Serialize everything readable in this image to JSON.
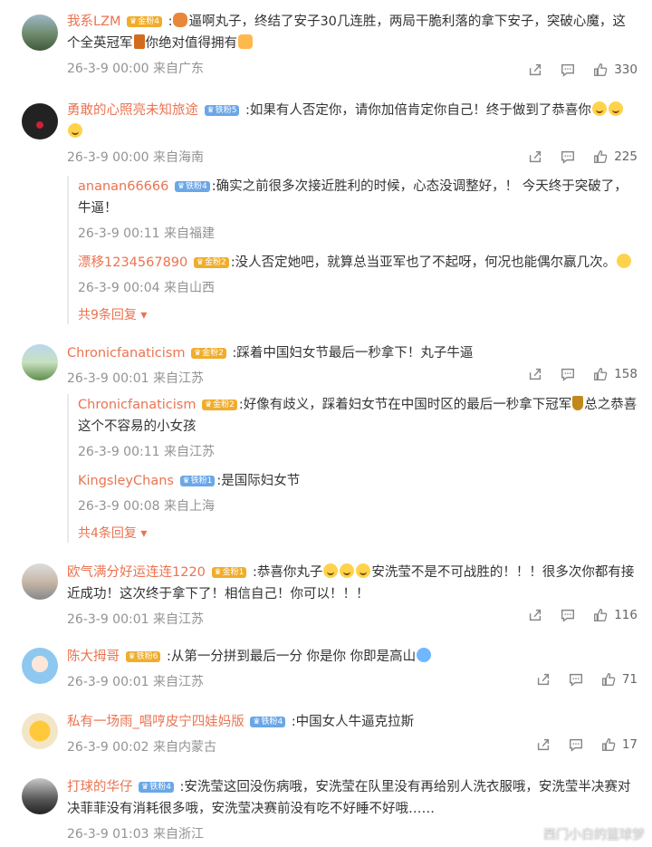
{
  "comments": [
    {
      "user": "我系LZM",
      "badge": "金粉4",
      "text": "逼啊丸子，终结了安子30几连胜，两局干脆利落的拿下安子，突破心魔，这个全英冠军",
      "text2": "你绝对值得拥有",
      "time": "26-3-9 00:00 来自广东",
      "likes": "330"
    },
    {
      "user": "勇敢的心照亮未知旅途",
      "badge": "铁粉5",
      "text": "如果有人否定你，请你加倍肯定你自己！终于做到了恭喜你",
      "time": "26-3-9 00:00 来自海南",
      "likes": "225",
      "replies": [
        {
          "user": "ananan66666",
          "badge": "铁粉4",
          "text": "确实之前很多次接近胜利的时候，心态没调整好，！ 今天终于突破了，牛逼！",
          "time": "26-3-9 00:11 来自福建"
        },
        {
          "user": "漂移1234567890",
          "badge": "金粉2",
          "text": "没人否定她吧，就算总当亚军也了不起呀，何况也能偶尔赢几次。",
          "time": "26-3-9 00:04 来自山西"
        }
      ],
      "more": "共9条回复"
    },
    {
      "user": "Chronicfanaticism",
      "badge": "金粉2",
      "text": "踩着中国妇女节最后一秒拿下！丸子牛逼",
      "time": "26-3-9 00:01 来自江苏",
      "likes": "158",
      "replies": [
        {
          "user": "Chronicfanaticism",
          "badge": "金粉2",
          "text": "好像有歧义，踩着妇女节在中国时区的最后一秒拿下冠军",
          "text2": "总之恭喜这个不容易的小女孩",
          "time": "26-3-9 00:11 来自江苏"
        },
        {
          "user": "KingsleyChans",
          "badge": "铁粉1",
          "text": "是国际妇女节",
          "time": "26-3-9 00:08 来自上海"
        }
      ],
      "more": "共4条回复"
    },
    {
      "user": "欧气满分好运连连1220",
      "badge": "金粉1",
      "text": "恭喜你丸子",
      "text2": "安洗莹不是不可战胜的！！！很多次你都有接近成功！这次终于拿下了！相信自己！你可以！！！",
      "time": "26-3-9 00:01 来自江苏",
      "likes": "116"
    },
    {
      "user": "陈大拇哥",
      "badge": "铁粉6",
      "text": "从第一分拼到最后一分 你是你 你即是高山",
      "time": "26-3-9 00:01 来自江苏",
      "likes": "71"
    },
    {
      "user": "私有一场雨_唱哼皮宁四娃妈版",
      "badge": "铁粉4",
      "text": "中国女人牛逼克拉斯",
      "time": "26-3-9 00:02 来自内蒙古",
      "likes": "17"
    },
    {
      "user": "打球的华仔",
      "badge": "铁粉4",
      "text": "安洗莹这回没伤病哦，安洗莹在队里没有再给别人洗衣服哦，安洗莹半决赛对决菲菲没有消耗很多哦，安洗莹决赛前没有吃不好睡不好哦……",
      "time": "26-3-9 01:03 来自浙江",
      "likes": ""
    }
  ],
  "watermark": "西门小白的篮球梦",
  "colors": {
    "username": "#eb7350",
    "meta": "#939393",
    "gold_badge": "#f0ad2c",
    "iron_badge": "#6aa7e8"
  }
}
